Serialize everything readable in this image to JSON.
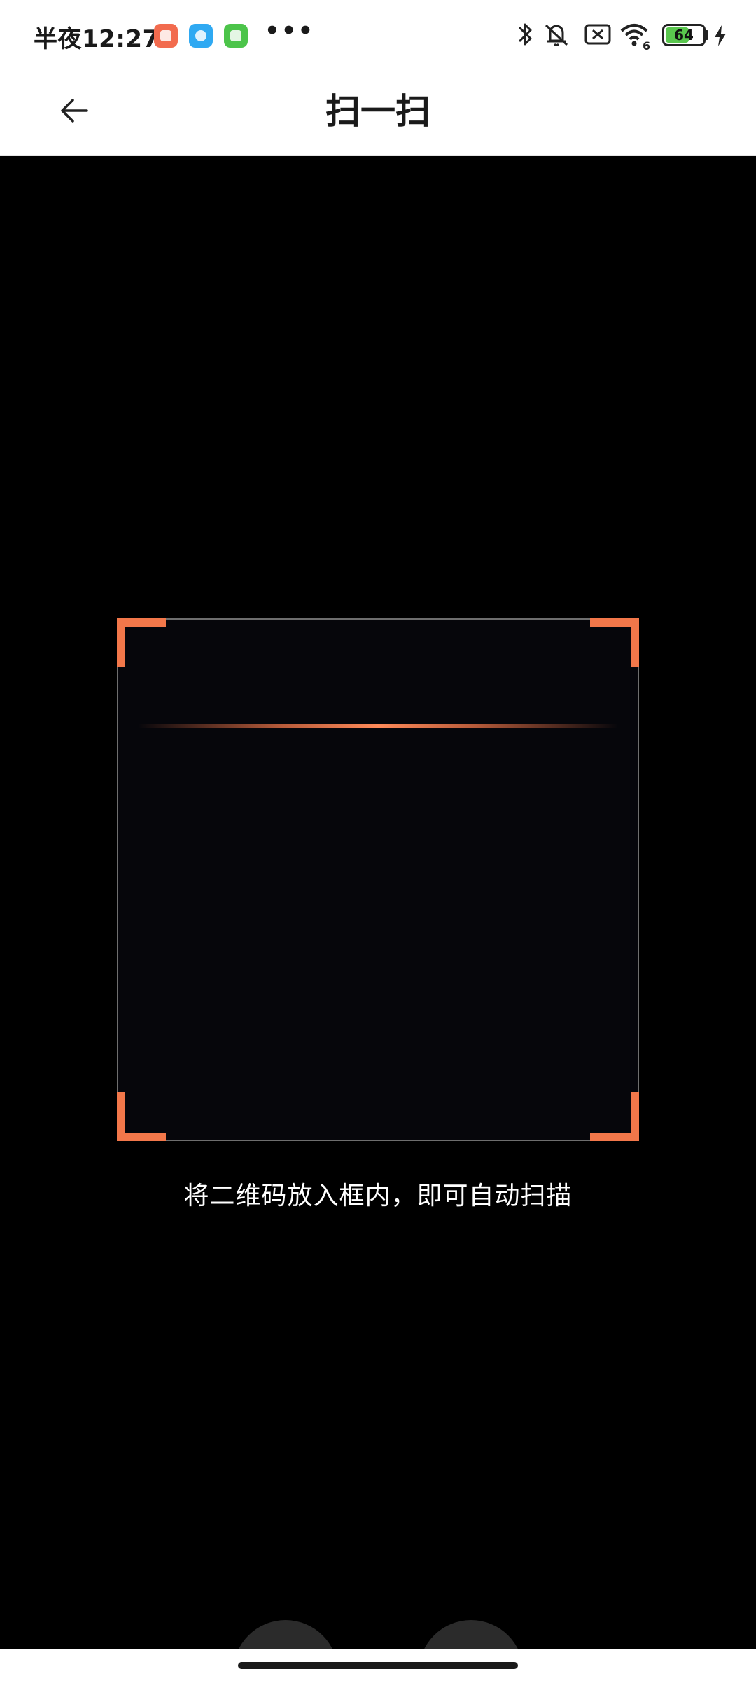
{
  "status_bar": {
    "time": "半夜12:27",
    "more": "•••",
    "battery_level": "64",
    "battery_percent": 64,
    "notification_icons": [
      "app-red-icon",
      "app-blue-icon",
      "app-green-icon"
    ],
    "system_icons": [
      "bluetooth-icon",
      "mute-icon",
      "sim-off-icon",
      "wifi-icon",
      "battery-icon",
      "charging-icon"
    ],
    "wifi_badge": "6"
  },
  "header": {
    "title": "扫一扫",
    "back_icon": "arrow-left-icon"
  },
  "scanner": {
    "hint": "将二维码放入框内，即可自动扫描",
    "accent_color": "#f2774a"
  },
  "actions": {
    "gallery_icon": "photo-library-icon",
    "flash_icon": "flash-off-icon"
  }
}
